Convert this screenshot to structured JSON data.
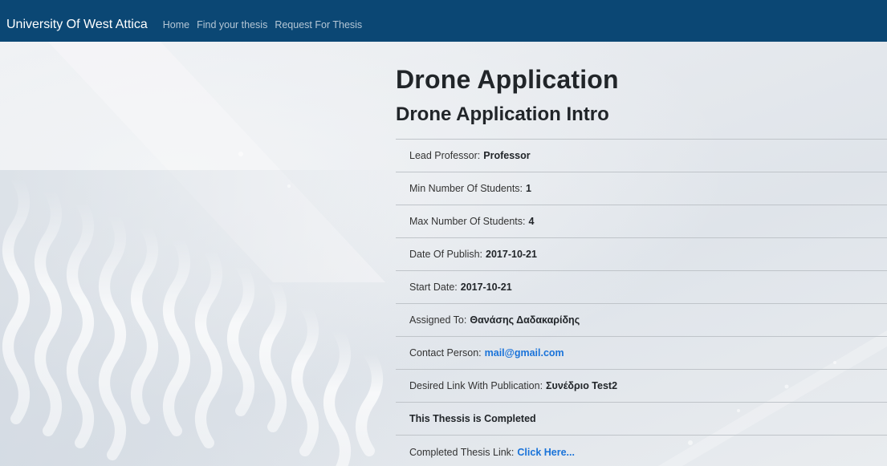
{
  "navbar": {
    "brand": "University Of West Attica",
    "links": [
      "Home",
      "Find your thesis",
      "Request For Thesis"
    ]
  },
  "thesis": {
    "title": "Drone Application",
    "subtitle": "Drone Application Intro",
    "fields": {
      "lead_professor": {
        "label": "Lead Professor:",
        "value": "Professor"
      },
      "min_students": {
        "label": "Min Number Of Students:",
        "value": "1"
      },
      "max_students": {
        "label": "Max Number Of Students:",
        "value": "4"
      },
      "date_of_publish": {
        "label": "Date Of Publish:",
        "value": "2017-10-21"
      },
      "start_date": {
        "label": "Start Date:",
        "value": "2017-10-21"
      },
      "assigned_to": {
        "label": "Assigned To:",
        "value": "Θανάσης Δαδακαρίδης"
      },
      "contact_person": {
        "label": "Contact Person:",
        "value": "mail@gmail.com"
      },
      "desired_link": {
        "label": "Desired Link With Publication:",
        "value": "Συνέδριο Test2"
      },
      "status": "This Thessis is Completed",
      "completed_link": {
        "label": "Completed Thesis Link:",
        "value": "Click Here..."
      }
    }
  },
  "colors": {
    "navbar": "#0b4774",
    "link": "#1a73d9",
    "background": "#e7eaee"
  }
}
